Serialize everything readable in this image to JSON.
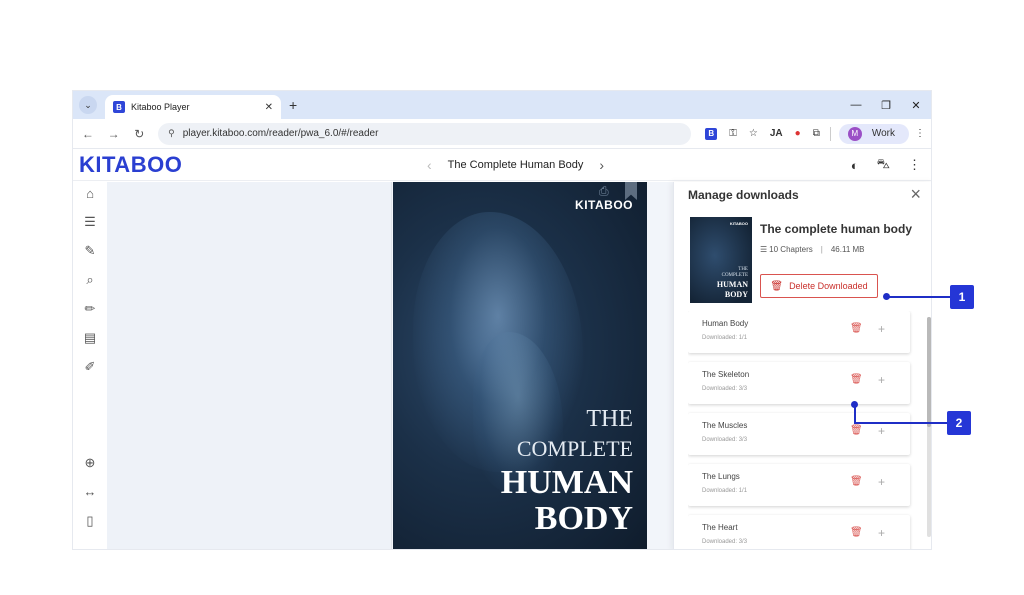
{
  "browser": {
    "tab_title": "Kitaboo Player",
    "tab_favicon": "B",
    "url": "player.kitaboo.com/reader/pwa_6.0/#/reader",
    "profile_label": "Work",
    "profile_initial": "M"
  },
  "app": {
    "logo": "KITABOO",
    "book_title": "The Complete Human Body"
  },
  "cover": {
    "brand": "KITABOO",
    "line1": "THE",
    "line2": "COMPLETE",
    "line3": "HUMAN",
    "line4": "BODY"
  },
  "panel": {
    "title": "Manage downloads",
    "book_title": "The complete human body",
    "chapters_count": "10 Chapters",
    "size": "46.11 MB",
    "delete_label": "Delete Downloaded",
    "chapters": [
      {
        "name": "Human Body",
        "status": "Downloaded: 1/1"
      },
      {
        "name": "The Skeleton",
        "status": "Downloaded: 3/3"
      },
      {
        "name": "The Muscles",
        "status": "Downloaded: 3/3"
      },
      {
        "name": "The Lungs",
        "status": "Downloaded: 1/1"
      },
      {
        "name": "The Heart",
        "status": "Downloaded: 3/3"
      }
    ]
  },
  "callouts": [
    "1",
    "2"
  ],
  "colors": {
    "accent": "#2a3fd1",
    "danger": "#d9534f",
    "callout": "#2536d6"
  }
}
